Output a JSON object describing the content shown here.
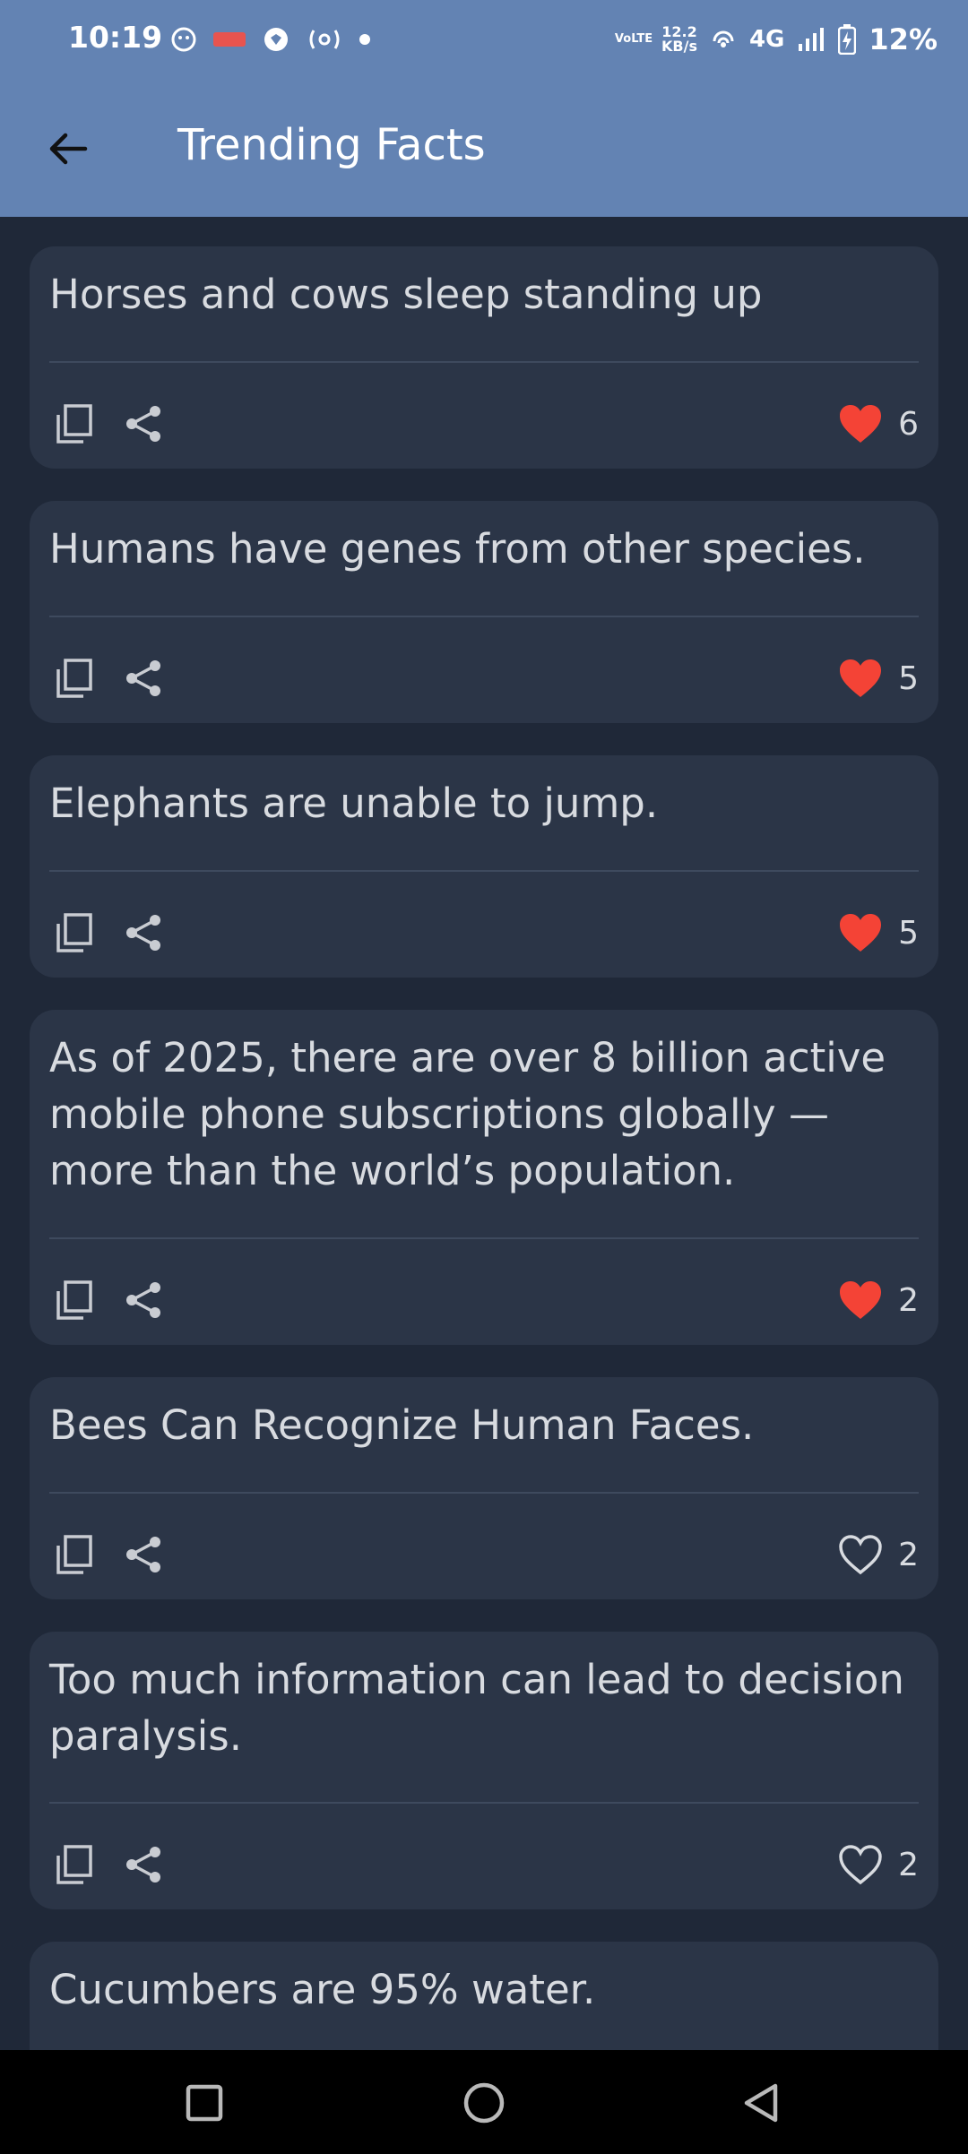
{
  "status_bar": {
    "time": "10:19",
    "net_type": "VoLTE",
    "net_speed_value": "12.2",
    "net_speed_unit": "KB/s",
    "cellular": "4G",
    "battery": "12%",
    "left_icons": [
      "notification-bot-icon",
      "app-notification-icon",
      "shield-notification-icon",
      "hotspot-icon",
      "dot-icon"
    ]
  },
  "app_bar": {
    "title": "Trending Facts",
    "background": "#6383b3"
  },
  "colors": {
    "background": "#1f2838",
    "card": "#2b3547",
    "text": "#d8dbe0",
    "like_active": "#f44336"
  },
  "facts": [
    {
      "text": "Horses and cows sleep standing up",
      "likes": "6",
      "liked": true
    },
    {
      "text": "Humans have genes from other species.",
      "likes": "5",
      "liked": true
    },
    {
      "text": "Elephants are unable to jump.",
      "likes": "5",
      "liked": true
    },
    {
      "text": "As of 2025, there are over 8 billion active mobile phone subscriptions globally — more than the world’s population.",
      "likes": "2",
      "liked": true
    },
    {
      "text": "Bees Can Recognize Human Faces.",
      "likes": "2",
      "liked": false
    },
    {
      "text": "Too much information can lead to decision paralysis.",
      "likes": "2",
      "liked": false
    },
    {
      "text": "Cucumbers are 95% water.",
      "likes": "",
      "liked": false
    }
  ],
  "nav_bar": {
    "buttons": [
      "recents-square-icon",
      "home-circle-icon",
      "back-triangle-icon"
    ]
  }
}
